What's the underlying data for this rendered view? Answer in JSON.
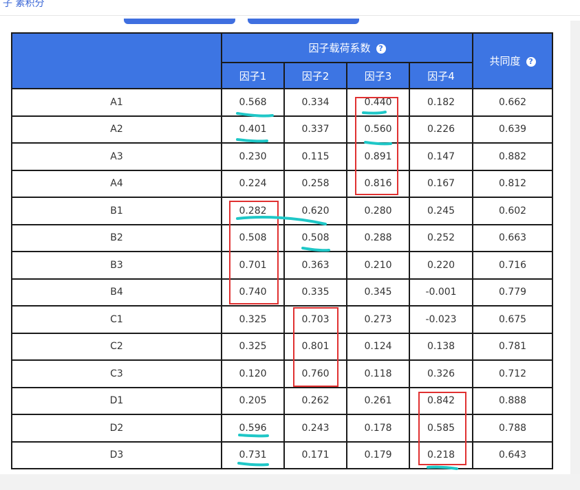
{
  "breadcrumb": "子    素积分",
  "table": {
    "group_header": "因子载荷系数",
    "communality_header": "共同度",
    "factor_headers": [
      "因子1",
      "因子2",
      "因子3",
      "因子4"
    ],
    "rows": [
      {
        "label": "A1",
        "f1": "0.568",
        "f2": "0.334",
        "f3": "0.440",
        "f4": "0.182",
        "h": "0.662"
      },
      {
        "label": "A2",
        "f1": "0.401",
        "f2": "0.337",
        "f3": "0.560",
        "f4": "0.226",
        "h": "0.639"
      },
      {
        "label": "A3",
        "f1": "0.230",
        "f2": "0.115",
        "f3": "0.891",
        "f4": "0.147",
        "h": "0.882"
      },
      {
        "label": "A4",
        "f1": "0.224",
        "f2": "0.258",
        "f3": "0.816",
        "f4": "0.167",
        "h": "0.812"
      },
      {
        "label": "B1",
        "f1": "0.282",
        "f2": "0.620",
        "f3": "0.280",
        "f4": "0.245",
        "h": "0.602"
      },
      {
        "label": "B2",
        "f1": "0.508",
        "f2": "0.508",
        "f3": "0.288",
        "f4": "0.252",
        "h": "0.663"
      },
      {
        "label": "B3",
        "f1": "0.701",
        "f2": "0.363",
        "f3": "0.210",
        "f4": "0.220",
        "h": "0.716"
      },
      {
        "label": "B4",
        "f1": "0.740",
        "f2": "0.335",
        "f3": "0.345",
        "f4": "-0.001",
        "h": "0.779"
      },
      {
        "label": "C1",
        "f1": "0.325",
        "f2": "0.703",
        "f3": "0.273",
        "f4": "-0.023",
        "h": "0.675"
      },
      {
        "label": "C2",
        "f1": "0.325",
        "f2": "0.801",
        "f3": "0.124",
        "f4": "0.138",
        "h": "0.781"
      },
      {
        "label": "C3",
        "f1": "0.120",
        "f2": "0.760",
        "f3": "0.118",
        "f4": "0.326",
        "h": "0.712"
      },
      {
        "label": "D1",
        "f1": "0.205",
        "f2": "0.262",
        "f3": "0.261",
        "f4": "0.842",
        "h": "0.888"
      },
      {
        "label": "D2",
        "f1": "0.596",
        "f2": "0.243",
        "f3": "0.178",
        "f4": "0.585",
        "h": "0.788"
      },
      {
        "label": "D3",
        "f1": "0.731",
        "f2": "0.171",
        "f3": "0.179",
        "f4": "0.218",
        "h": "0.643"
      }
    ]
  },
  "colors": {
    "header_bg": "#3d75e3",
    "highlight_box": "#e03030",
    "underline": "#1fc7c7"
  },
  "icons": {
    "help": "question-circle-icon"
  }
}
